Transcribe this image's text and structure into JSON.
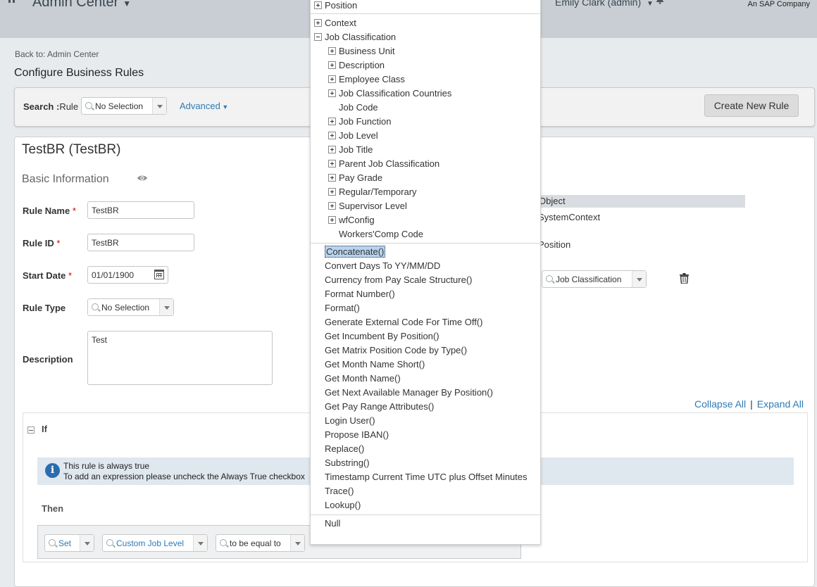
{
  "header": {
    "app_title": "Admin Center",
    "user_label": "Emily Clark (admin)",
    "brand_tagline": "An SAP Company"
  },
  "breadcrumb": "Back to: Admin Center",
  "page_title": "Configure Business Rules",
  "search": {
    "label_bold": "Search :",
    "label_rest": "Rule",
    "selection": "No Selection",
    "advanced": "Advanced",
    "create_button": "Create New Rule"
  },
  "rule": {
    "title": "TestBR (TestBR)",
    "section": "Basic Information",
    "fields": {
      "rule_name_label": "Rule Name",
      "rule_name_value": "TestBR",
      "rule_id_label": "Rule ID",
      "rule_id_value": "TestBR",
      "start_date_label": "Start Date",
      "start_date_value": "01/01/1900",
      "rule_type_label": "Rule Type",
      "rule_type_value": "No Selection",
      "description_label": "Description",
      "description_value": "Test"
    },
    "required_mark": "*",
    "object_header": "Object",
    "object_values": [
      "SystemContext",
      "Position"
    ],
    "job_classification_combo": "Job Classification"
  },
  "links": {
    "collapse": "Collapse All",
    "separator": "|",
    "expand": "Expand All"
  },
  "if_section": {
    "label": "If",
    "info_line1": "This rule is always true",
    "info_line2": "To add an expression please uncheck the Always True checkbox",
    "then_label": "Then",
    "then_row": {
      "action": "Set",
      "field": "Custom Job Level",
      "operator": "to be equal to"
    }
  },
  "dropdown": {
    "top_items": [
      "Position",
      "Context"
    ],
    "expanded_item": "Job Classification",
    "children": [
      {
        "label": "Business Unit",
        "expandable": true
      },
      {
        "label": "Description",
        "expandable": true
      },
      {
        "label": "Employee Class",
        "expandable": true
      },
      {
        "label": "Job Classification Countries",
        "expandable": true
      },
      {
        "label": "Job Code",
        "expandable": false
      },
      {
        "label": "Job Function",
        "expandable": true
      },
      {
        "label": "Job Level",
        "expandable": true
      },
      {
        "label": "Job Title",
        "expandable": true
      },
      {
        "label": "Parent Job Classification",
        "expandable": true
      },
      {
        "label": "Pay Grade",
        "expandable": true
      },
      {
        "label": "Regular/Temporary",
        "expandable": true
      },
      {
        "label": "Supervisor Level",
        "expandable": true
      },
      {
        "label": "wfConfig",
        "expandable": true
      },
      {
        "label": "Workers'Comp Code",
        "expandable": false
      }
    ],
    "functions": [
      "Concatenate()",
      "Convert Days To YY/MM/DD",
      "Currency from Pay Scale Structure()",
      "Format Number()",
      "Format()",
      "Generate External Code For Time Off()",
      "Get Incumbent By Position()",
      "Get Matrix Position Code by Type()",
      "Get Month Name Short()",
      "Get Month Name()",
      "Get Next Available Manager By Position()",
      "Get Pay Range Attributes()",
      "Login User()",
      "Propose IBAN()",
      "Replace()",
      "Substring()",
      "Timestamp Current Time UTC plus Offset Minutes",
      "Trace()",
      "Lookup()"
    ],
    "selected_function": "Concatenate()",
    "null_item": "Null"
  },
  "colors": {
    "link": "#2d7bb5",
    "topbar": "#c8ced3",
    "selection": "#b7d3f0",
    "info_icon": "#2b6cae"
  }
}
